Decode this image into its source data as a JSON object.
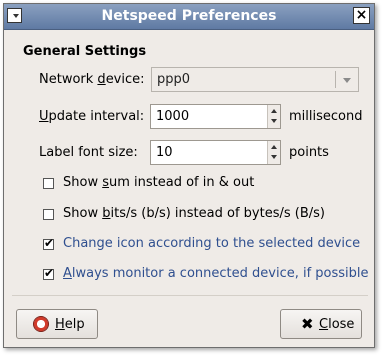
{
  "window": {
    "title": "Netspeed Preferences"
  },
  "section": {
    "heading": "General Settings"
  },
  "network_device": {
    "label": "Network device:",
    "label_u": "d",
    "value": "ppp0"
  },
  "update_interval": {
    "label_u": "U",
    "label_rest": "pdate interval:",
    "value": "1000",
    "unit": "millisecond"
  },
  "font_size": {
    "label": "Label font size:",
    "value": "10",
    "unit": "points"
  },
  "checkboxes": [
    {
      "pre": "Show ",
      "u": "s",
      "post": "um instead of in & out",
      "checked": false
    },
    {
      "pre": "Show ",
      "u": "b",
      "post": "its/s (b/s) instead of bytes/s (B/s)",
      "checked": false
    },
    {
      "pre": "Change icon according to the selected device",
      "u": "",
      "post": "",
      "checked": true
    },
    {
      "pre": "",
      "u": "A",
      "post": "lways monitor a connected device, if possible",
      "checked": true
    }
  ],
  "check_mark": "✔",
  "buttons": {
    "help_u": "H",
    "help_rest": "elp",
    "close_glyph": "✖",
    "close_u": "C",
    "close_rest": "lose"
  }
}
